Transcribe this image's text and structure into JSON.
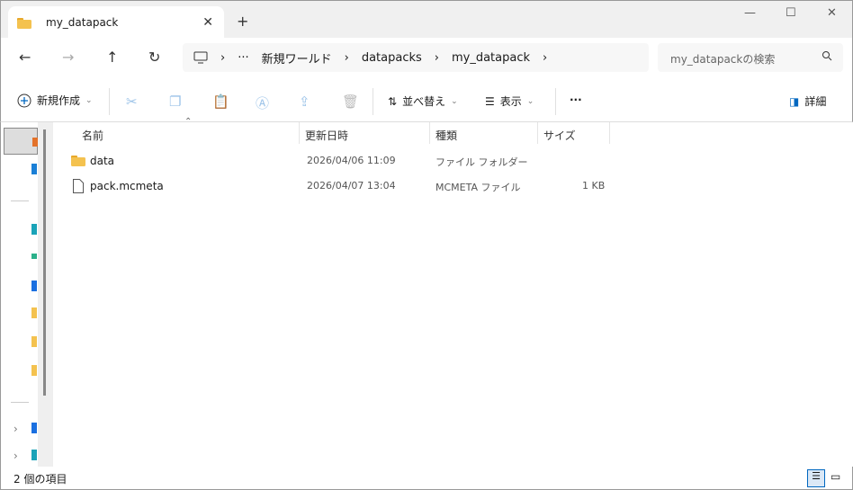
{
  "window": {
    "tab_title": "my_datapack",
    "close": "✕",
    "new_tab": "+",
    "minimize": "—",
    "maximize": "☐",
    "close_window": "✕"
  },
  "nav": {
    "back": "←",
    "forward": "→",
    "up": "↑",
    "refresh": "↻",
    "breadcrumb": [
      "新規ワールド",
      "datapacks",
      "my_datapack"
    ],
    "ellipsis": "···",
    "sep": "›",
    "search_placeholder": "my_datapackの検索"
  },
  "toolbar": {
    "new": "新規作成",
    "sort": "並べ替え",
    "view": "表示",
    "more": "···",
    "details": "詳細"
  },
  "columns": {
    "name": "名前",
    "modified": "更新日時",
    "type": "種類",
    "size": "サイズ"
  },
  "files": [
    {
      "name": "data",
      "modified": "2026/04/06 11:09",
      "type": "ファイル フォルダー",
      "size": "",
      "icon": "folder-icon"
    },
    {
      "name": "pack.mcmeta",
      "modified": "2026/04/07 13:04",
      "type": "MCMETA ファイル",
      "size": "1 KB",
      "icon": "file-icon"
    }
  ],
  "status": {
    "count": "2 個の項目"
  },
  "colors": {
    "folder": "#f4b83b",
    "accent": "#0067c0"
  }
}
